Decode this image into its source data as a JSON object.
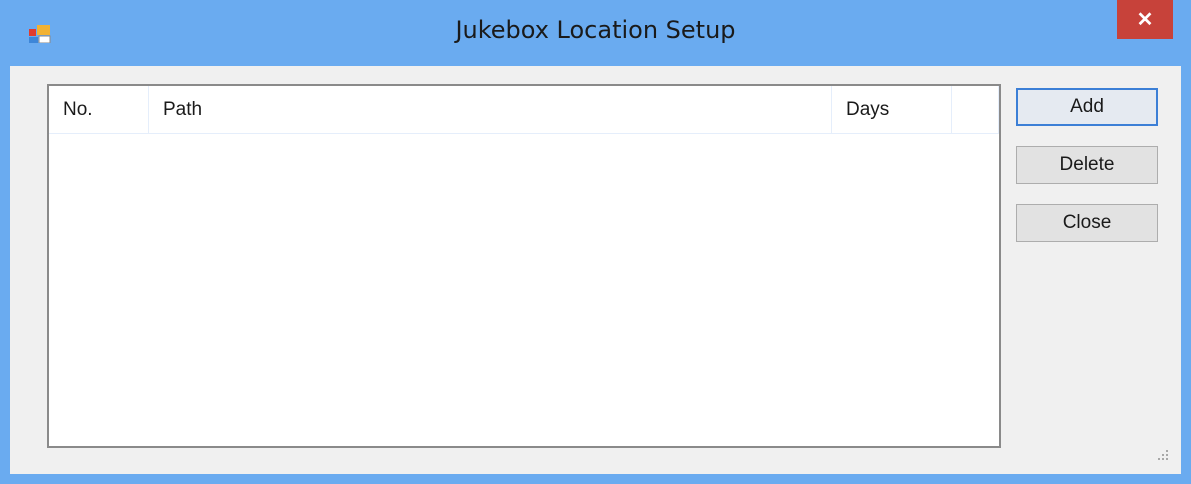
{
  "window": {
    "title": "Jukebox Location Setup",
    "close_symbol": "✕"
  },
  "listview": {
    "columns": [
      "No.",
      "Path",
      "Days",
      ""
    ],
    "rows": []
  },
  "buttons": {
    "add": "Add",
    "delete": "Delete",
    "close": "Close"
  },
  "icons": {
    "app": "app-icon",
    "close": "close-icon",
    "grip": "resize-grip-icon"
  },
  "colors": {
    "titlebar": "#6aabf0",
    "close_bg": "#c7423a",
    "client_bg": "#f0f0f0"
  }
}
